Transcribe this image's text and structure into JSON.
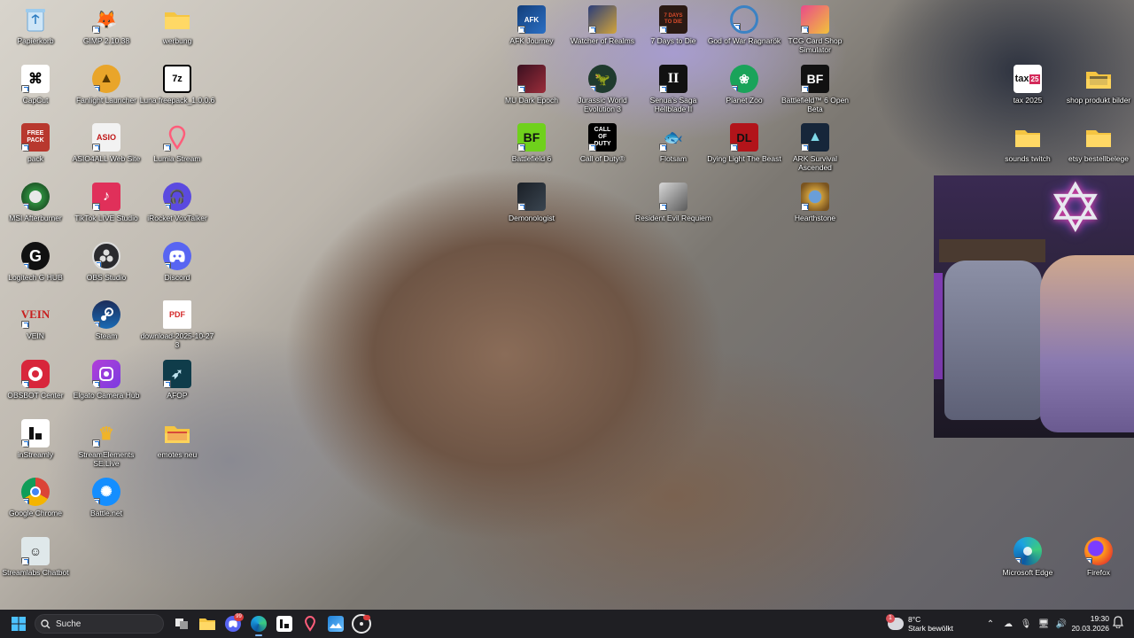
{
  "desktop": {
    "icons": [
      {
        "label": "Papierkorb",
        "icon": "recycle-bin-icon"
      },
      {
        "label": "GIMP 2.10.38",
        "icon": "gimp-icon"
      },
      {
        "label": "werbung",
        "icon": "folder-icon"
      },
      {
        "label": "CapCut",
        "icon": "capcut-icon"
      },
      {
        "label": "Fanlight Launcher",
        "icon": "fanlight-launcher-icon"
      },
      {
        "label": "Luna freepack_1.0.0.6",
        "icon": "7zip-archive-icon"
      },
      {
        "label": "pack",
        "icon": "free-pack-icon"
      },
      {
        "label": "ASIO4ALL Web Site",
        "icon": "asio4all-icon"
      },
      {
        "label": "Lumia Stream",
        "icon": "lumia-stream-icon"
      },
      {
        "label": "MSI Afterburner",
        "icon": "msi-afterburner-icon"
      },
      {
        "label": "TikTok LIVE Studio",
        "icon": "tiktok-live-icon"
      },
      {
        "label": "iRocket VoxTalker",
        "icon": "voxtalker-icon"
      },
      {
        "label": "Logitech G HUB",
        "icon": "logitech-ghub-icon"
      },
      {
        "label": "OBS Studio",
        "icon": "obs-studio-icon"
      },
      {
        "label": "Discord",
        "icon": "discord-icon"
      },
      {
        "label": "VEIN",
        "icon": "vein-icon"
      },
      {
        "label": "Steam",
        "icon": "steam-icon"
      },
      {
        "label": "download-2025-10-27 3",
        "icon": "pdf-file-icon"
      },
      {
        "label": "OBSBOT Center",
        "icon": "obsbot-icon"
      },
      {
        "label": "Elgato Camera Hub",
        "icon": "elgato-camera-hub-icon"
      },
      {
        "label": "AFOP",
        "icon": "afop-icon"
      },
      {
        "label": "inStreamly",
        "icon": "instreamly-icon"
      },
      {
        "label": "StreamElements SE.Live",
        "icon": "streamelements-icon"
      },
      {
        "label": "emotes neu",
        "icon": "folder-emotes-icon"
      },
      {
        "label": "Google Chrome",
        "icon": "chrome-icon"
      },
      {
        "label": "Battle.net",
        "icon": "battlenet-icon"
      },
      {
        "label": "Streamlabs Chatbot",
        "icon": "streamlabs-chatbot-icon"
      },
      {
        "label": "AFK Journey",
        "icon": "afk-journey-icon"
      },
      {
        "label": "Watcher of Realms",
        "icon": "watcher-of-realms-icon"
      },
      {
        "label": "7 Days to Die",
        "icon": "7-days-to-die-icon"
      },
      {
        "label": "God of War Ragnarök",
        "icon": "god-of-war-icon"
      },
      {
        "label": "TCG Card Shop Simulator",
        "icon": "tcg-card-shop-icon"
      },
      {
        "label": "MU Dark Epoch",
        "icon": "mu-dark-epoch-icon"
      },
      {
        "label": "Jurassic World Evolution 3",
        "icon": "jurassic-world-icon"
      },
      {
        "label": "Senua's Saga Hellblade II",
        "icon": "hellblade-icon"
      },
      {
        "label": "Planet Zoo",
        "icon": "planet-zoo-icon"
      },
      {
        "label": "Battlefield™ 6 Open Beta",
        "icon": "battlefield-beta-icon"
      },
      {
        "label": "Battlefield 6",
        "icon": "battlefield-6-icon"
      },
      {
        "label": "Call of Duty®",
        "icon": "call-of-duty-icon"
      },
      {
        "label": "Flotsam",
        "icon": "flotsam-icon"
      },
      {
        "label": "Dying Light The Beast",
        "icon": "dying-light-icon"
      },
      {
        "label": "ARK Survival Ascended",
        "icon": "ark-icon"
      },
      {
        "label": "Demonologist",
        "icon": "demonologist-icon"
      },
      {
        "label": "Resident Evil Requiem",
        "icon": "resident-evil-icon"
      },
      {
        "label": "Hearthstone",
        "icon": "hearthstone-icon"
      },
      {
        "label": "tax 2025",
        "icon": "tax-2025-icon"
      },
      {
        "label": "shop produkt bilder",
        "icon": "folder-images-icon"
      },
      {
        "label": "sounds twitch",
        "icon": "folder-icon"
      },
      {
        "label": "etsy bestellbelege",
        "icon": "folder-icon"
      },
      {
        "label": "Microsoft Edge",
        "icon": "edge-icon"
      },
      {
        "label": "Firefox",
        "icon": "firefox-icon"
      }
    ]
  },
  "taskbar": {
    "search_placeholder": "Suche",
    "apps": [
      {
        "name": "task-view",
        "icon": "task-view-icon"
      },
      {
        "name": "file-explorer",
        "icon": "file-explorer-icon"
      },
      {
        "name": "discord",
        "icon": "discord-icon",
        "badge": "99"
      },
      {
        "name": "edge",
        "icon": "edge-icon",
        "active": true
      },
      {
        "name": "instreamly",
        "icon": "instreamly-icon"
      },
      {
        "name": "lumia-stream",
        "icon": "lumia-stream-icon"
      },
      {
        "name": "photos",
        "icon": "photos-icon"
      },
      {
        "name": "obsbot",
        "icon": "obsbot-icon"
      }
    ],
    "weather": {
      "badge": "1",
      "temp": "8°C",
      "desc": "Stark bewölkt"
    },
    "clock": {
      "time": "19:30",
      "date": "20.03.2026"
    }
  },
  "colors": {
    "taskbar_bg": "#1f1f23",
    "accent": "#7ab4ff"
  }
}
